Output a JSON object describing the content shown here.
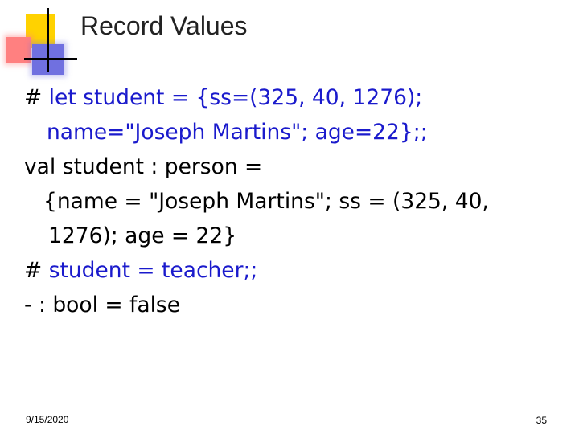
{
  "slide": {
    "title": "Record Values",
    "lines": [
      {
        "prompt": "#",
        "text": "let student = {ss=(325, 40, 1276);"
      },
      {
        "text": "name=\"Joseph Martins\"; age=22};;"
      },
      {
        "text": "val student : person ="
      },
      {
        "text": "{name = \"Joseph Martins\"; ss = (325, 40,"
      },
      {
        "text": "1276); age = 22}"
      },
      {
        "prompt": "#",
        "text": "student = teacher;;"
      },
      {
        "text": "- : bool = false"
      }
    ],
    "footer": {
      "date": "9/15/2020",
      "page": "35"
    },
    "colors": {
      "command": "#1a1acc",
      "logo_yellow": "#ffd200",
      "logo_pink": "#ff8080",
      "logo_blue": "#7070e0"
    }
  }
}
